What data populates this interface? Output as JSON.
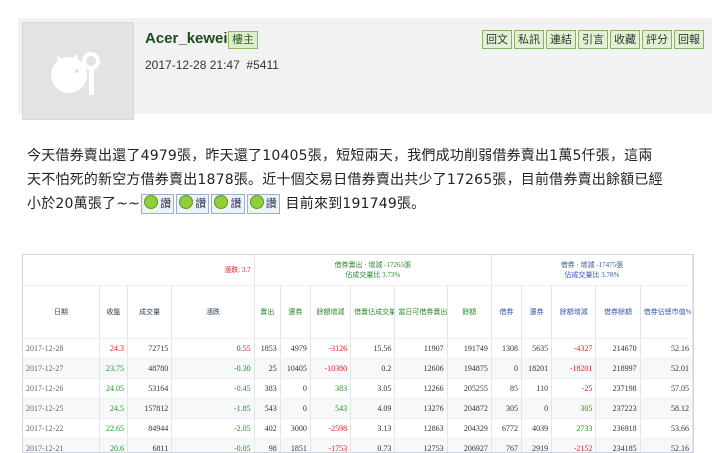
{
  "post": {
    "username": "Acer_kewei",
    "role": "樓主",
    "datetime": "2017-12-28 21:47",
    "post_no": "#5411",
    "actions": [
      "回文",
      "私訊",
      "連結",
      "引言",
      "收藏",
      "評分",
      "回報"
    ],
    "body_lines": [
      "今天借券賣出還了4979張，昨天還了10405張，短短兩天，我們成功削弱借券賣出1萬5仟張，這兩",
      "天不怕死的新空方借券賣出1878張。近十個交易日借券賣出共少了17265張，目前借券賣出餘額已經",
      "小於20萬張了~~"
    ],
    "emoticon_label": "讚",
    "emoticon_count": 4,
    "body_tail": " 目前來到191749張。"
  },
  "table": {
    "top_label": "漲跌: 3.7",
    "group_green": "借券賣出 · 增減 -17265張",
    "group_green_sub": "佔成交量比 3.73%",
    "group_blue": "借券 · 增減 -17475張",
    "group_blue_sub": "佔成交量比 3.78%",
    "columns": [
      "日期",
      "收盤",
      "成交量",
      "漲跌",
      "賣出",
      "還券",
      "餘額增減",
      "借賣佔成交量%",
      "當日可借券賣出股數",
      "餘額",
      "借券",
      "還券",
      "餘額增減",
      "借券餘額",
      "借券佔總市值%"
    ],
    "rows": [
      [
        "2017-12-28",
        "24.3",
        "72715",
        "0.55",
        "1853",
        "4979",
        "-3126",
        "15.56",
        "11907",
        "191749",
        "1308",
        "5635",
        "-4327",
        "214670",
        "52.16"
      ],
      [
        "2017-12-27",
        "23.75",
        "48780",
        "-0.30",
        "25",
        "10405",
        "-10380",
        "0.2",
        "12606",
        "194875",
        "0",
        "18201",
        "-18201",
        "218997",
        "52.01"
      ],
      [
        "2017-12-26",
        "24.05",
        "53164",
        "-0.45",
        "383",
        "0",
        "383",
        "3.05",
        "12266",
        "205255",
        "85",
        "110",
        "-25",
        "237198",
        "57.05"
      ],
      [
        "2017-12-25",
        "24.5",
        "157812",
        "-1.85",
        "543",
        "0",
        "543",
        "4.09",
        "13276",
        "204872",
        "305",
        "0",
        "305",
        "237223",
        "58.12"
      ],
      [
        "2017-12-22",
        "22.65",
        "84944",
        "-2.05",
        "402",
        "3000",
        "-2598",
        "3.13",
        "12863",
        "204329",
        "6772",
        "4039",
        "2733",
        "236918",
        "53.66"
      ],
      [
        "2017-12-21",
        "20.6",
        "6811",
        "-0.05",
        "98",
        "1851",
        "-1753",
        "0.73",
        "12753",
        "206927",
        "767",
        "2919",
        "-2152",
        "234185",
        "52.16"
      ]
    ]
  }
}
